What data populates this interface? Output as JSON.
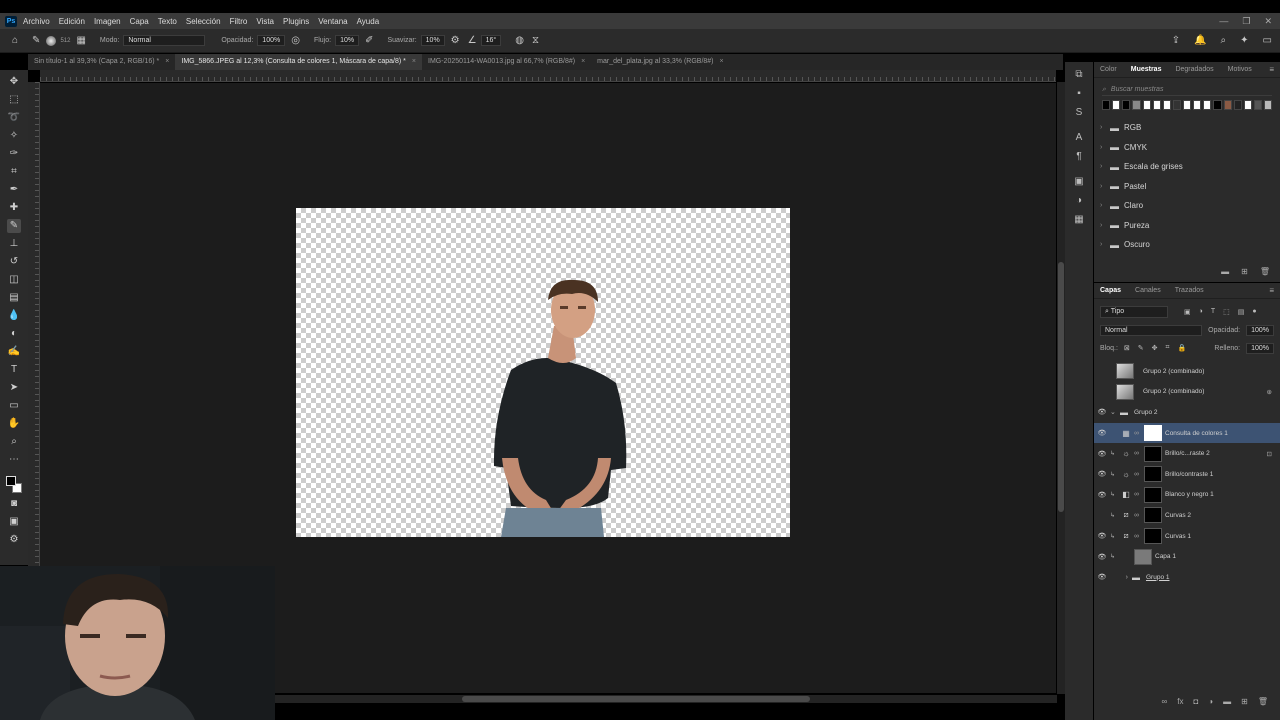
{
  "app": {
    "logo": "Ps"
  },
  "menu": [
    "Archivo",
    "Edición",
    "Imagen",
    "Capa",
    "Texto",
    "Selección",
    "Filtro",
    "Vista",
    "Plugins",
    "Ventana",
    "Ayuda"
  ],
  "options": {
    "brush_size": "512",
    "mode_label": "Modo:",
    "mode_value": "Normal",
    "opacity_label": "Opacidad:",
    "opacity_value": "100%",
    "flow_label": "Flujo:",
    "flow_value": "10%",
    "smooth_label": "Suavizar:",
    "smooth_value": "10%",
    "angle_value": "16°"
  },
  "tabs": [
    {
      "label": "Sin título-1 al 39,3% (Capa 2, RGB/16) *"
    },
    {
      "label": "IMG_5866.JPEG al 12,3% (Consulta de colores 1, Máscara de capa/8) *"
    },
    {
      "label": "IMG-20250114-WA0013.jpg al 66,7% (RGB/8#)"
    },
    {
      "label": "mar_del_plata.jpg al 33,3% (RGB/8#)"
    }
  ],
  "swatches_panel": {
    "tabs": [
      "Color",
      "Muestras",
      "Degradados",
      "Motivos"
    ],
    "search_placeholder": "Buscar muestras",
    "colors": [
      "#000000",
      "#ffffff",
      "#000000",
      "#888888",
      "#ffffff",
      "#ffffff",
      "#ffffff",
      "#333333",
      "#ffffff",
      "#ffffff",
      "#ffffff",
      "#000000",
      "#8a5a44",
      "#222222",
      "#ffffff",
      "#555555",
      "#bbbbbb"
    ],
    "folders": [
      "RGB",
      "CMYK",
      "Escala de grises",
      "Pastel",
      "Claro",
      "Pureza",
      "Oscuro"
    ]
  },
  "layers_panel": {
    "tabs": [
      "Capas",
      "Canales",
      "Trazados"
    ],
    "filter": "Tipo",
    "blend_mode": "Normal",
    "opacity_label": "Opacidad:",
    "opacity_value": "100%",
    "lock_label": "Bloq.:",
    "fill_label": "Relleno:",
    "fill_value": "100%",
    "layers": [
      {
        "name": "Grupo 2 (combinado)"
      },
      {
        "name": "Grupo 2 (combinado)"
      },
      {
        "name": "Grupo 2"
      },
      {
        "name": "Consulta de colores 1"
      },
      {
        "name": "Brillo/c...raste 2"
      },
      {
        "name": "Brillo/contraste 1"
      },
      {
        "name": "Blanco y negro 1"
      },
      {
        "name": "Curvas 2"
      },
      {
        "name": "Curvas 1"
      },
      {
        "name": "Capa 1"
      },
      {
        "name": "Grupo 1"
      }
    ]
  }
}
